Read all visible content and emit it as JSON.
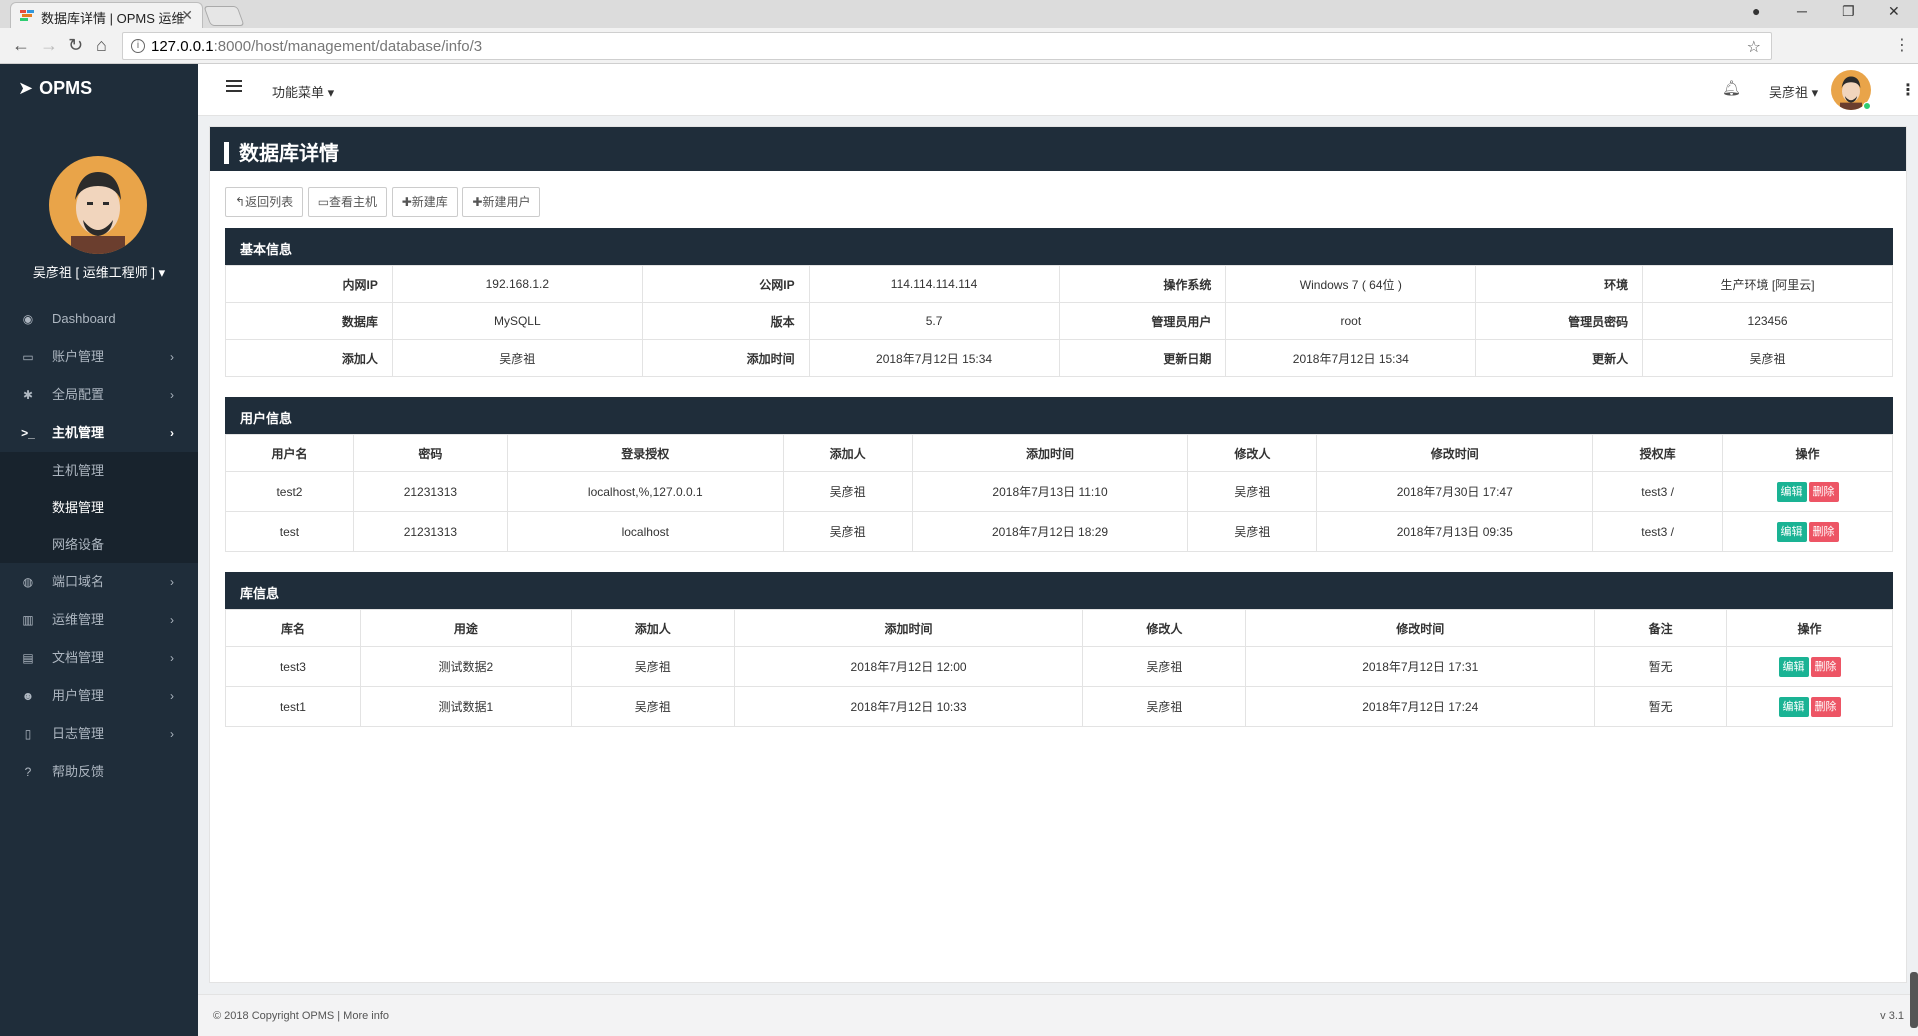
{
  "browser": {
    "tab_title": "数据库详情 | OPMS 运维",
    "url_host": "127.0.0.1",
    "url_rest": ":8000/host/management/database/info/3"
  },
  "app": {
    "logo": "OPMS",
    "user_display": "吴彦祖 [ 运维工程师 ]",
    "top_menu": "功能菜单",
    "top_user": "吴彦祖"
  },
  "sidebar": {
    "items": [
      {
        "label": "Dashboard",
        "icon": "dashboard-icon"
      },
      {
        "label": "账户管理",
        "icon": "monitor-icon"
      },
      {
        "label": "全局配置",
        "icon": "gear-icon"
      },
      {
        "label": "主机管理",
        "icon": "terminal-icon"
      },
      {
        "label": "端口域名",
        "icon": "globe-icon"
      },
      {
        "label": "运维管理",
        "icon": "bar-chart-icon"
      },
      {
        "label": "文档管理",
        "icon": "book-icon"
      },
      {
        "label": "用户管理",
        "icon": "users-icon"
      },
      {
        "label": "日志管理",
        "icon": "file-icon"
      },
      {
        "label": "帮助反馈",
        "icon": "question-icon"
      }
    ],
    "sub_items": [
      "主机管理",
      "数据管理",
      "网络设备"
    ]
  },
  "page": {
    "title": "数据库详情",
    "buttons": [
      "返回列表",
      "查看主机",
      "新建库",
      "新建用户"
    ]
  },
  "basic": {
    "heading": "基本信息",
    "rows": [
      [
        [
          "内网IP",
          "192.168.1.2"
        ],
        [
          "公网IP",
          "114.114.114.114"
        ],
        [
          "操作系统",
          "Windows 7 ( 64位 )"
        ],
        [
          "环境",
          "生产环境 [阿里云]"
        ]
      ],
      [
        [
          "数据库",
          "MySQLL"
        ],
        [
          "版本",
          "5.7"
        ],
        [
          "管理员用户",
          "root"
        ],
        [
          "管理员密码",
          "123456"
        ]
      ],
      [
        [
          "添加人",
          "吴彦祖"
        ],
        [
          "添加时间",
          "2018年7月12日 15:34"
        ],
        [
          "更新日期",
          "2018年7月12日 15:34"
        ],
        [
          "更新人",
          "吴彦祖"
        ]
      ]
    ]
  },
  "users": {
    "heading": "用户信息",
    "columns": [
      "用户名",
      "密码",
      "登录授权",
      "添加人",
      "添加时间",
      "修改人",
      "修改时间",
      "授权库",
      "操作"
    ],
    "rows": [
      [
        "test2",
        "21231313",
        "localhost,%,127.0.0.1",
        "吴彦祖",
        "2018年7月13日 11:10",
        "吴彦祖",
        "2018年7月30日 17:47",
        "test3 /"
      ],
      [
        "test",
        "21231313",
        "localhost",
        "吴彦祖",
        "2018年7月12日 18:29",
        "吴彦祖",
        "2018年7月13日 09:35",
        "test3 /"
      ]
    ]
  },
  "dbs": {
    "heading": "库信息",
    "columns": [
      "库名",
      "用途",
      "添加人",
      "添加时间",
      "修改人",
      "修改时间",
      "备注",
      "操作"
    ],
    "rows": [
      [
        "test3",
        "测试数据2",
        "吴彦祖",
        "2018年7月12日 12:00",
        "吴彦祖",
        "2018年7月12日 17:31",
        "暂无"
      ],
      [
        "test1",
        "测试数据1",
        "吴彦祖",
        "2018年7月12日 10:33",
        "吴彦祖",
        "2018年7月12日 17:24",
        "暂无"
      ]
    ]
  },
  "actions": {
    "edit": "编辑",
    "delete": "删除"
  },
  "footer": {
    "copyright": "© 2018 Copyright OPMS | More info",
    "version": "v 3.1"
  },
  "colors": {
    "sidebar": "#1f2d3a",
    "edit": "#1ab394",
    "delete": "#ed5565"
  }
}
